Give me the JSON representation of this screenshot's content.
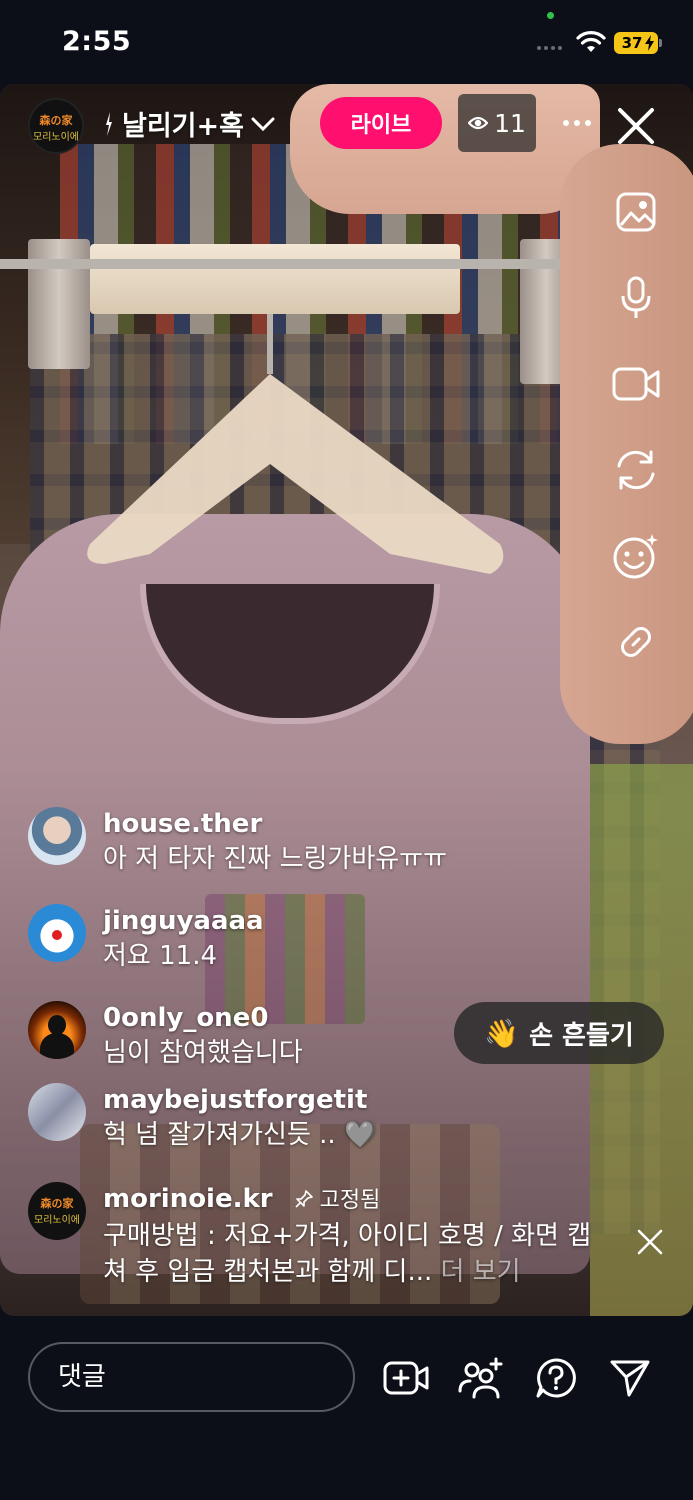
{
  "status_bar": {
    "time": "2:55",
    "battery": "37"
  },
  "header": {
    "host_avatar_line1": "森の家",
    "host_avatar_line2": "모리노이에",
    "title": "날리기+혹",
    "live_label": "라이브",
    "viewer_count": "11"
  },
  "right_toolbar": [
    "image-icon",
    "microphone-icon",
    "video-camera-icon",
    "switch-camera-icon",
    "effects-icon",
    "link-icon"
  ],
  "comments": [
    {
      "user": "house.ther",
      "text": "아 저 타자 진짜 느링가바유ㅠㅠ"
    },
    {
      "user": "jinguyaaaa",
      "text": "저요 11.4"
    },
    {
      "user": "0only_one0",
      "text": "님이 참여했습니다"
    },
    {
      "user": "maybejustforgetit",
      "text": "헉 넘 잘가져가신듯 .. 🩶"
    }
  ],
  "pinned": {
    "user": "morinoie.kr",
    "tag": "고정됨",
    "text": "구매방법 : 저요+가격, 아이디 호명 / 화면 캡쳐 후 입금 캡처본과 함께 디...",
    "more": "더 보기"
  },
  "wave_button": {
    "emoji": "👋",
    "label": "손 흔들기"
  },
  "bottom_bar": {
    "comment_placeholder": "댓글"
  },
  "colors": {
    "live_pink": "#ff0f6e",
    "background": "#0c0f17",
    "battery_yellow": "#f5c518"
  }
}
